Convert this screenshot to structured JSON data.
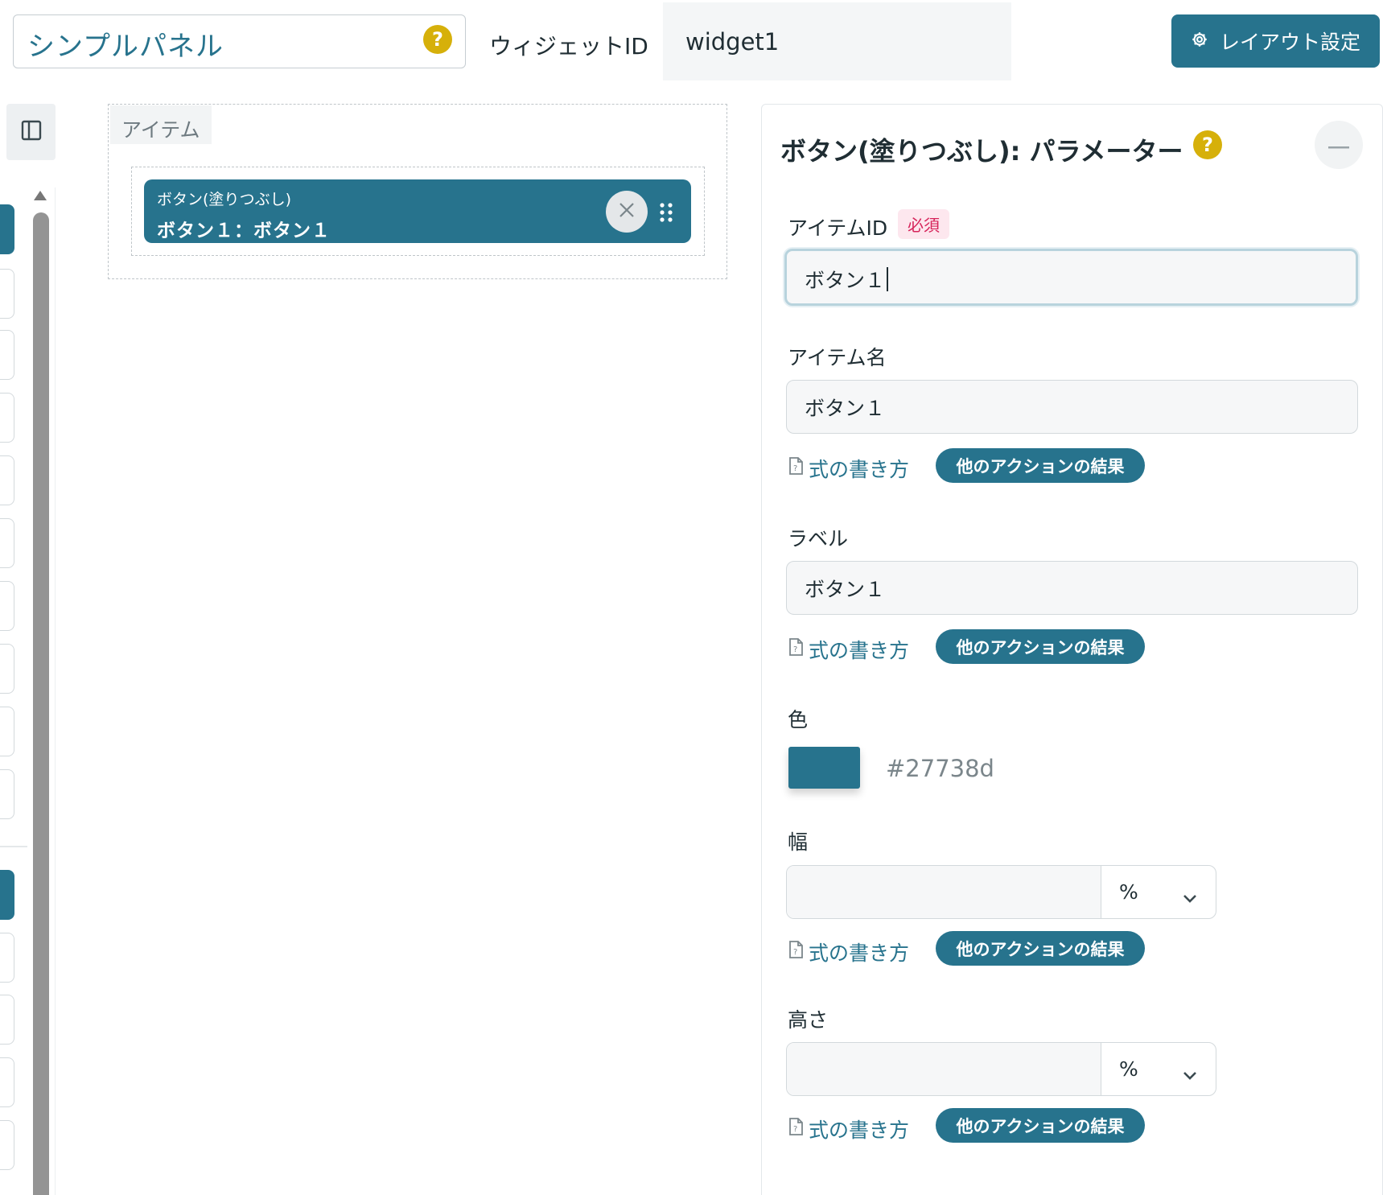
{
  "header": {
    "panel_name": "シンプルパネル",
    "help_icon": "?",
    "widget_id_label": "ウィジェットID",
    "widget_id_value": "widget1",
    "layout_button_label": "レイアウト設定"
  },
  "canvas": {
    "items_title": "アイテム",
    "card_type": "ボタン(塗りつぶし)",
    "card_name": "ボタン１：ボタン１"
  },
  "params": {
    "title": "ボタン(塗りつぶし): パラメーター",
    "help_icon": "?",
    "item_id": {
      "label": "アイテムID",
      "badge": "必須",
      "value": "ボタン１"
    },
    "item_name": {
      "label": "アイテム名",
      "value": "ボタン１"
    },
    "label": {
      "label": "ラベル",
      "value": "ボタン１"
    },
    "color": {
      "label": "色",
      "value": "#27738d"
    },
    "width": {
      "label": "幅",
      "value": "",
      "unit": "%"
    },
    "height": {
      "label": "高さ",
      "value": "",
      "unit": "%"
    },
    "formula_link": "式の書き方",
    "other_action_pill": "他のアクションの結果"
  },
  "colors": {
    "accent": "#27738d",
    "help": "#d6b00a",
    "required": "#d6245a"
  }
}
